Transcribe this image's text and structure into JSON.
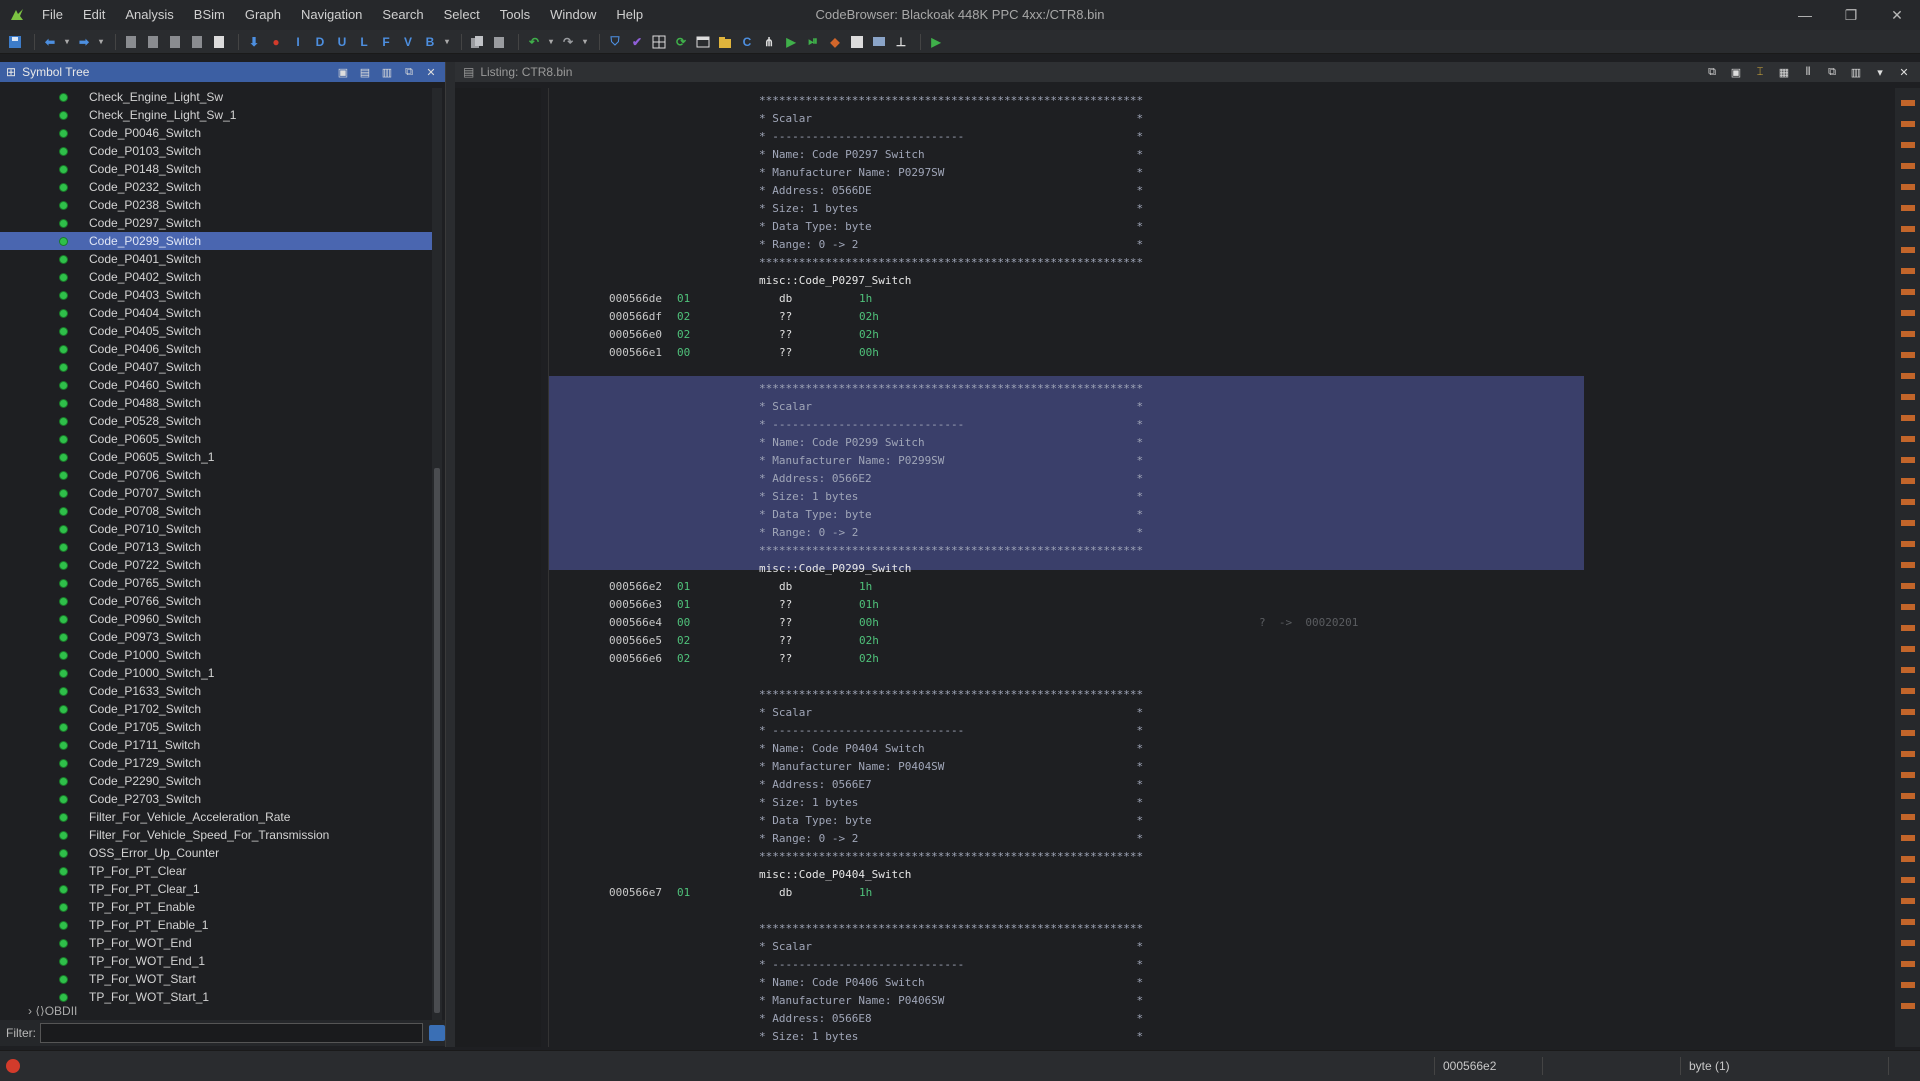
{
  "window": {
    "title": "CodeBrowser: Blackoak 448K PPC 4xx:/CTR8.bin",
    "minimize": "—",
    "restore": "❐",
    "close": "✕"
  },
  "menu": [
    "File",
    "Edit",
    "Analysis",
    "BSim",
    "Graph",
    "Navigation",
    "Search",
    "Select",
    "Tools",
    "Window",
    "Help"
  ],
  "toolbar": {
    "letters": [
      "I",
      "D",
      "U",
      "L",
      "F",
      "V",
      "B"
    ]
  },
  "symbol_tree": {
    "title": "Symbol Tree",
    "selected_index": 8,
    "items": [
      "Check_Engine_Light_Sw",
      "Check_Engine_Light_Sw_1",
      "Code_P0046_Switch",
      "Code_P0103_Switch",
      "Code_P0148_Switch",
      "Code_P0232_Switch",
      "Code_P0238_Switch",
      "Code_P0297_Switch",
      "Code_P0299_Switch",
      "Code_P0401_Switch",
      "Code_P0402_Switch",
      "Code_P0403_Switch",
      "Code_P0404_Switch",
      "Code_P0405_Switch",
      "Code_P0406_Switch",
      "Code_P0407_Switch",
      "Code_P0460_Switch",
      "Code_P0488_Switch",
      "Code_P0528_Switch",
      "Code_P0605_Switch",
      "Code_P0605_Switch_1",
      "Code_P0706_Switch",
      "Code_P0707_Switch",
      "Code_P0708_Switch",
      "Code_P0710_Switch",
      "Code_P0713_Switch",
      "Code_P0722_Switch",
      "Code_P0765_Switch",
      "Code_P0766_Switch",
      "Code_P0960_Switch",
      "Code_P0973_Switch",
      "Code_P1000_Switch",
      "Code_P1000_Switch_1",
      "Code_P1633_Switch",
      "Code_P1702_Switch",
      "Code_P1705_Switch",
      "Code_P1711_Switch",
      "Code_P1729_Switch",
      "Code_P2290_Switch",
      "Code_P2703_Switch",
      "Filter_For_Vehicle_Acceleration_Rate",
      "Filter_For_Vehicle_Speed_For_Transmission",
      "OSS_Error_Up_Counter",
      "TP_For_PT_Clear",
      "TP_For_PT_Clear_1",
      "TP_For_PT_Enable",
      "TP_For_PT_Enable_1",
      "TP_For_WOT_End",
      "TP_For_WOT_End_1",
      "TP_For_WOT_Start",
      "TP_For_WOT_Start_1"
    ],
    "partial_item": "OBDII",
    "filter_label": "Filter:",
    "filter_value": ""
  },
  "listing": {
    "title": "Listing:  CTR8.bin",
    "blocks": [
      {
        "header_lines": [
          "**********************************************************",
          "* Scalar                                                 *",
          "* -----------------------------                          *",
          "* Name: Code P0297 Switch                                *",
          "* Manufacturer Name: P0297SW                             *",
          "* Address: 0566DE                                        *",
          "* Size: 1 bytes                                          *",
          "* Data Type: byte                                        *",
          "* Range: 0 -> 2                                          *",
          "**********************************************************"
        ],
        "label": "misc::Code_P0297_Switch",
        "rows": [
          {
            "addr": "000566de",
            "byte": "01",
            "mnem": "db",
            "oper": "1h"
          },
          {
            "addr": "000566df",
            "byte": "02",
            "mnem": "??",
            "oper": "02h"
          },
          {
            "addr": "000566e0",
            "byte": "02",
            "mnem": "??",
            "oper": "02h"
          },
          {
            "addr": "000566e1",
            "byte": "00",
            "mnem": "??",
            "oper": "00h"
          }
        ]
      },
      {
        "header_lines": [
          "**********************************************************",
          "* Scalar                                                 *",
          "* -----------------------------                          *",
          "* Name: Code P0299 Switch                                *",
          "* Manufacturer Name: P0299SW                             *",
          "* Address: 0566E2                                        *",
          "* Size: 1 bytes                                          *",
          "* Data Type: byte                                        *",
          "* Range: 0 -> 2                                          *",
          "**********************************************************"
        ],
        "label": "misc::Code_P0299_Switch",
        "rows": [
          {
            "addr": "000566e2",
            "byte": "01",
            "mnem": "db",
            "oper": "1h"
          },
          {
            "addr": "000566e3",
            "byte": "01",
            "mnem": "??",
            "oper": "01h"
          },
          {
            "addr": "000566e4",
            "byte": "00",
            "mnem": "??",
            "oper": "00h"
          },
          {
            "addr": "000566e5",
            "byte": "02",
            "mnem": "??",
            "oper": "02h"
          },
          {
            "addr": "000566e6",
            "byte": "02",
            "mnem": "??",
            "oper": "02h"
          }
        ],
        "xref": "?  ->  00020201"
      },
      {
        "header_lines": [
          "**********************************************************",
          "* Scalar                                                 *",
          "* -----------------------------                          *",
          "* Name: Code P0404 Switch                                *",
          "* Manufacturer Name: P0404SW                             *",
          "* Address: 0566E7                                        *",
          "* Size: 1 bytes                                          *",
          "* Data Type: byte                                        *",
          "* Range: 0 -> 2                                          *",
          "**********************************************************"
        ],
        "label": "misc::Code_P0404_Switch",
        "rows": [
          {
            "addr": "000566e7",
            "byte": "01",
            "mnem": "db",
            "oper": "1h"
          }
        ]
      },
      {
        "header_lines": [
          "**********************************************************",
          "* Scalar                                                 *",
          "* -----------------------------                          *",
          "* Name: Code P0406 Switch                                *",
          "* Manufacturer Name: P0406SW                             *",
          "* Address: 0566E8                                        *",
          "* Size: 1 bytes                                          *"
        ]
      }
    ]
  },
  "status": {
    "address": "000566e2",
    "type": "byte (1)"
  },
  "colors": {
    "selection": "#4a66b0",
    "highlight_block": "#3a3f6a",
    "tree_dot": "#2fc04a",
    "operand": "#4fc17a"
  }
}
